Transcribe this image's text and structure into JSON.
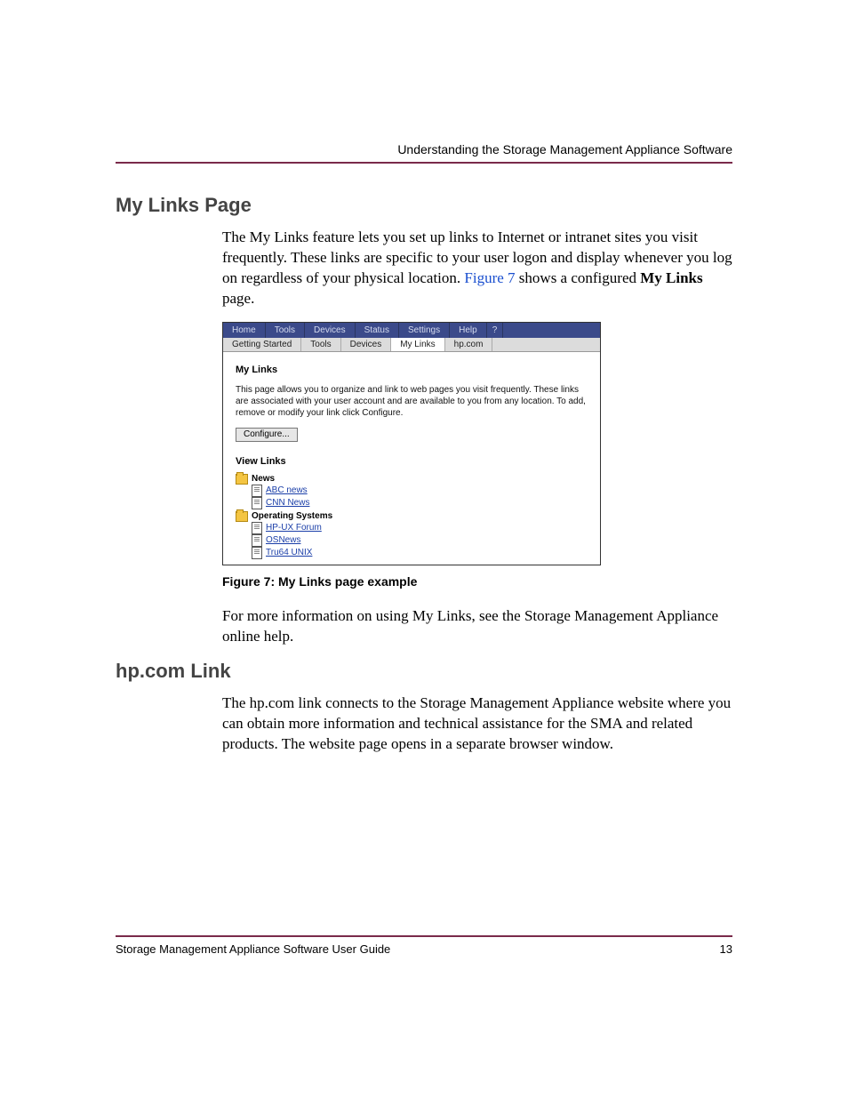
{
  "header": {
    "running_title": "Understanding the Storage Management Appliance Software"
  },
  "section1": {
    "heading": "My Links Page",
    "para1_pre": "The My Links feature lets you set up links to Internet or intranet sites you visit frequently. These links are specific to your user logon and display whenever you log on regardless of your physical location. ",
    "para1_link": "Figure 7",
    "para1_mid": " shows a configured ",
    "para1_bold": "My Links",
    "para1_post": " page.",
    "para2": "For more information on using My Links, see the Storage Management Appliance online help."
  },
  "figure7": {
    "caption": "Figure 7:  My Links page example",
    "tabs_primary": [
      "Home",
      "Tools",
      "Devices",
      "Status",
      "Settings",
      "Help",
      "?"
    ],
    "tabs_secondary": [
      "Getting Started",
      "Tools",
      "Devices",
      "My Links",
      "hp.com"
    ],
    "panel_title": "My Links",
    "panel_desc": "This page allows you to organize and link to web pages you visit frequently. These links are associated with your user account and are available to you from any location. To add, remove or modify your link click Configure.",
    "configure_btn": "Configure...",
    "view_links": "View Links",
    "tree": {
      "folder1": "News",
      "f1_items": [
        "ABC news",
        "CNN News"
      ],
      "folder2": "Operating Systems",
      "f2_items": [
        "HP-UX Forum",
        "OSNews",
        "Tru64 UNIX"
      ]
    }
  },
  "section2": {
    "heading": "hp.com Link",
    "para1": "The hp.com link connects to the Storage Management Appliance website where you can obtain more information and technical assistance for the SMA and related products. The website page opens in a separate browser window."
  },
  "footer": {
    "doc_title": "Storage Management Appliance Software User Guide",
    "page_num": "13"
  }
}
